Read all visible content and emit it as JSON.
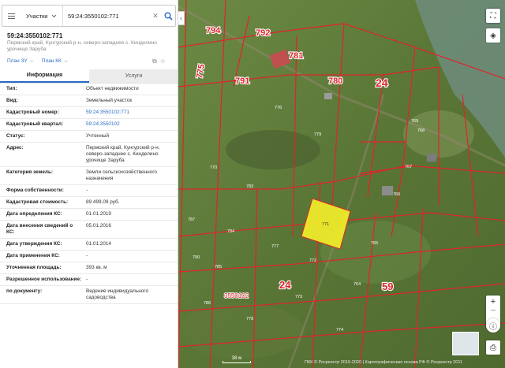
{
  "search": {
    "type_label": "Участки",
    "value": "59:24:3550102:771"
  },
  "parcel": {
    "title": "59:24:3550102:771",
    "address_line": "Пермский край, Кунгурский р-н, северо-западнее с. Кинделино урочище Заруба"
  },
  "links": {
    "plan_zu": "План ЗУ →",
    "plan_kk": "План КК →"
  },
  "tabs": [
    {
      "label": "Информация"
    },
    {
      "label": "Услуги"
    }
  ],
  "rows": [
    {
      "label": "Тип:",
      "value": "Объект недвижимости"
    },
    {
      "label": "Вид:",
      "value": "Земельный участок"
    },
    {
      "label": "Кадастровый номер:",
      "value": "59:24:3550102:771"
    },
    {
      "label": "Кадастровый квартал:",
      "value": "59:24:3550102"
    },
    {
      "label": "Статус:",
      "value": "Учтенный"
    },
    {
      "label": "Адрес:",
      "value": "Пермский край, Кунгурский р-н, северо-западнее с. Кинделино урочище Заруба"
    },
    {
      "label": "Категория земель:",
      "value": "Земли сельскохозяйственного назначения"
    },
    {
      "label": "Форма собственности:",
      "value": "-"
    },
    {
      "label": "Кадастровая стоимость:",
      "value": "89 499,09 руб."
    },
    {
      "label": "Дата определения КС:",
      "value": "01.01.2019"
    },
    {
      "label": "Дата внесения сведений о КС:",
      "value": "05.01.2016"
    },
    {
      "label": "Дата утверждения КС:",
      "value": "01.01.2014"
    },
    {
      "label": "Дата применения КС:",
      "value": "-"
    },
    {
      "label": "Уточненная площадь:",
      "value": "393 кв. м"
    },
    {
      "label": "Разрешенное использование:",
      "value": "-"
    },
    {
      "label": "по документу:",
      "value": "Ведение индивидуального садоводства"
    }
  ],
  "map": {
    "parcel_labels": [
      {
        "text": "794",
        "big": true
      },
      {
        "text": "792",
        "big": true
      },
      {
        "text": "781",
        "big": true
      },
      {
        "text": "791",
        "big": true
      },
      {
        "text": "780",
        "big": true
      },
      {
        "text": "24",
        "big": true
      },
      {
        "text": "775",
        "big": true
      },
      {
        "text": "59",
        "big": true
      },
      {
        "text": "24",
        "big": true
      },
      {
        "text": "3550102",
        "big": false
      },
      {
        "text": "771",
        "big": false
      },
      {
        "text": "776",
        "big": false
      },
      {
        "text": "769",
        "big": false
      },
      {
        "text": "770",
        "big": false
      },
      {
        "text": "779",
        "big": false
      },
      {
        "text": "768",
        "big": false
      },
      {
        "text": "767",
        "big": false
      },
      {
        "text": "766",
        "big": false
      },
      {
        "text": "765",
        "big": false
      },
      {
        "text": "772",
        "big": false
      },
      {
        "text": "777",
        "big": false
      },
      {
        "text": "773",
        "big": false
      },
      {
        "text": "778",
        "big": false
      },
      {
        "text": "783",
        "big": false
      },
      {
        "text": "784",
        "big": false
      },
      {
        "text": "785",
        "big": false
      },
      {
        "text": "786",
        "big": false
      },
      {
        "text": "787",
        "big": false
      },
      {
        "text": "790",
        "big": false
      },
      {
        "text": "764",
        "big": false
      },
      {
        "text": "774",
        "big": false
      }
    ],
    "scale_label": "38 м",
    "copyright": "ПКК © Росреестр 2010-2020 | Картографическая основа РФ © Росреестр 2011",
    "colors": {
      "boundary": "#e0242a",
      "selected_fill": "#f2ee2a",
      "water": "#6f8d7d"
    }
  }
}
